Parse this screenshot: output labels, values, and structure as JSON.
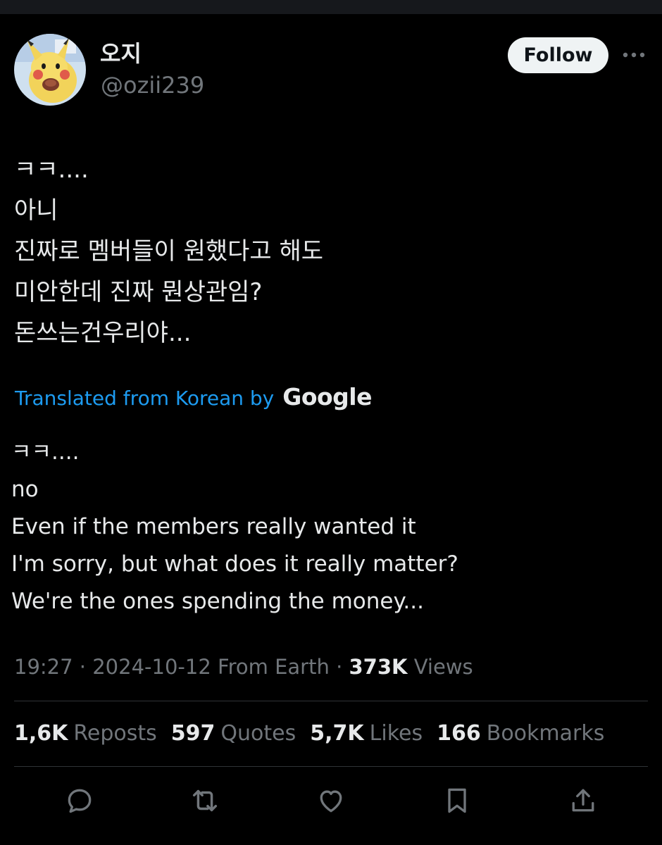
{
  "user": {
    "display_name": "오지",
    "handle": "@ozii239"
  },
  "follow_label": "Follow",
  "tweet": {
    "korean_lines": [
      "ㅋㅋ....",
      "아니",
      "진짜로 멤버들이 원했다고 해도",
      "미안한데 진짜 뭔상관임?",
      "돈쓰는건우리야..."
    ],
    "translated_label": "Translated from Korean by",
    "translator_brand": "Google",
    "english_lines": [
      "ㅋㅋ....",
      "no",
      "Even if the members really wanted it",
      "I'm sorry, but what does it really matter?",
      "We're the ones spending the money..."
    ]
  },
  "meta": {
    "time": "19:27",
    "date": "2024-10-12",
    "source": "From Earth",
    "views_count": "373K",
    "views_label": "Views"
  },
  "stats": {
    "reposts_count": "1,6K",
    "reposts_label": "Reposts",
    "quotes_count": "597",
    "quotes_label": "Quotes",
    "likes_count": "5,7K",
    "likes_label": "Likes",
    "bookmarks_count": "166",
    "bookmarks_label": "Bookmarks"
  },
  "actions": [
    "reply-icon",
    "repost-icon",
    "like-icon",
    "bookmark-icon",
    "share-icon"
  ],
  "colors": {
    "background": "#000000",
    "text": "#e7e9ea",
    "muted": "#71767b",
    "link": "#1d9bf0",
    "divider": "#2f3336",
    "follow_bg": "#eff3f4"
  }
}
